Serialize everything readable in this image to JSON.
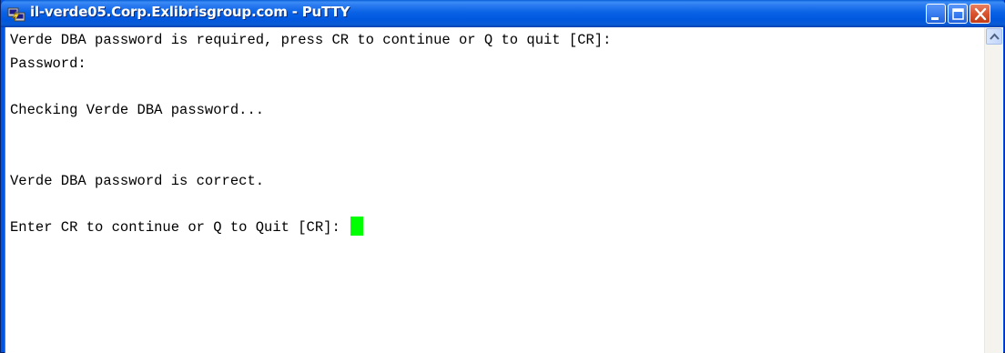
{
  "window": {
    "title": "il-verde05.Corp.Exlibrisgroup.com - PuTTY",
    "icon": "putty-icon",
    "controls": [
      "minimize-icon",
      "maximize-icon",
      "close-icon"
    ]
  },
  "terminal": {
    "lines": [
      "Verde DBA password is required, press CR to continue or Q to quit [CR]:",
      "Password:",
      "",
      "Checking Verde DBA password...",
      "",
      "",
      "Verde DBA password is correct.",
      "",
      "Enter CR to continue or Q to Quit [CR]: "
    ],
    "cursor_color": "#00ff00",
    "background": "#ffffff",
    "foreground": "#000000"
  },
  "scrollbar": {
    "up_icon": "scroll-up-arrow-icon"
  }
}
